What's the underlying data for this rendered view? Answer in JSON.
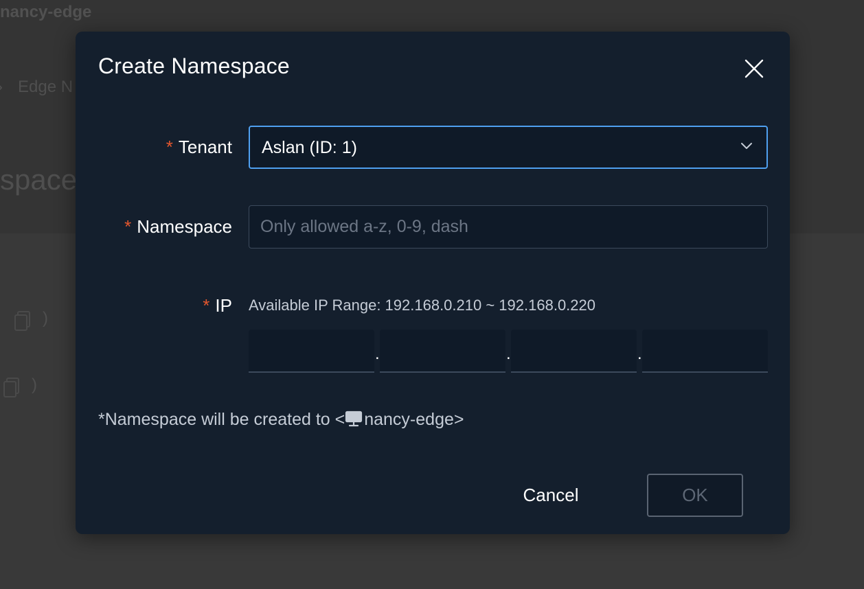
{
  "background": {
    "title": "nancy-edge",
    "breadcrumb_separator": "›",
    "breadcrumb": "Edge N",
    "heading": "space",
    "row_suffix": ")"
  },
  "modal": {
    "title": "Create Namespace",
    "close_icon": "close-icon",
    "tenant": {
      "required_mark": "*",
      "label": "Tenant",
      "value": "Aslan (ID: 1)"
    },
    "namespace": {
      "required_mark": "*",
      "label": "Namespace",
      "value": "",
      "placeholder": "Only allowed a-z, 0-9, dash"
    },
    "ip": {
      "required_mark": "*",
      "label": "IP",
      "hint": "Available IP Range: 192.168.0.210 ~ 192.168.0.220",
      "octets": [
        "",
        "",
        "",
        ""
      ],
      "separator": "."
    },
    "note_prefix": "*Namespace will be created to <",
    "note_device": "nancy-edge>",
    "buttons": {
      "cancel": "Cancel",
      "ok": "OK"
    }
  },
  "colors": {
    "modal_bg": "#141f2d",
    "required": "#e4572e",
    "focus_border": "#4fa0f0"
  }
}
